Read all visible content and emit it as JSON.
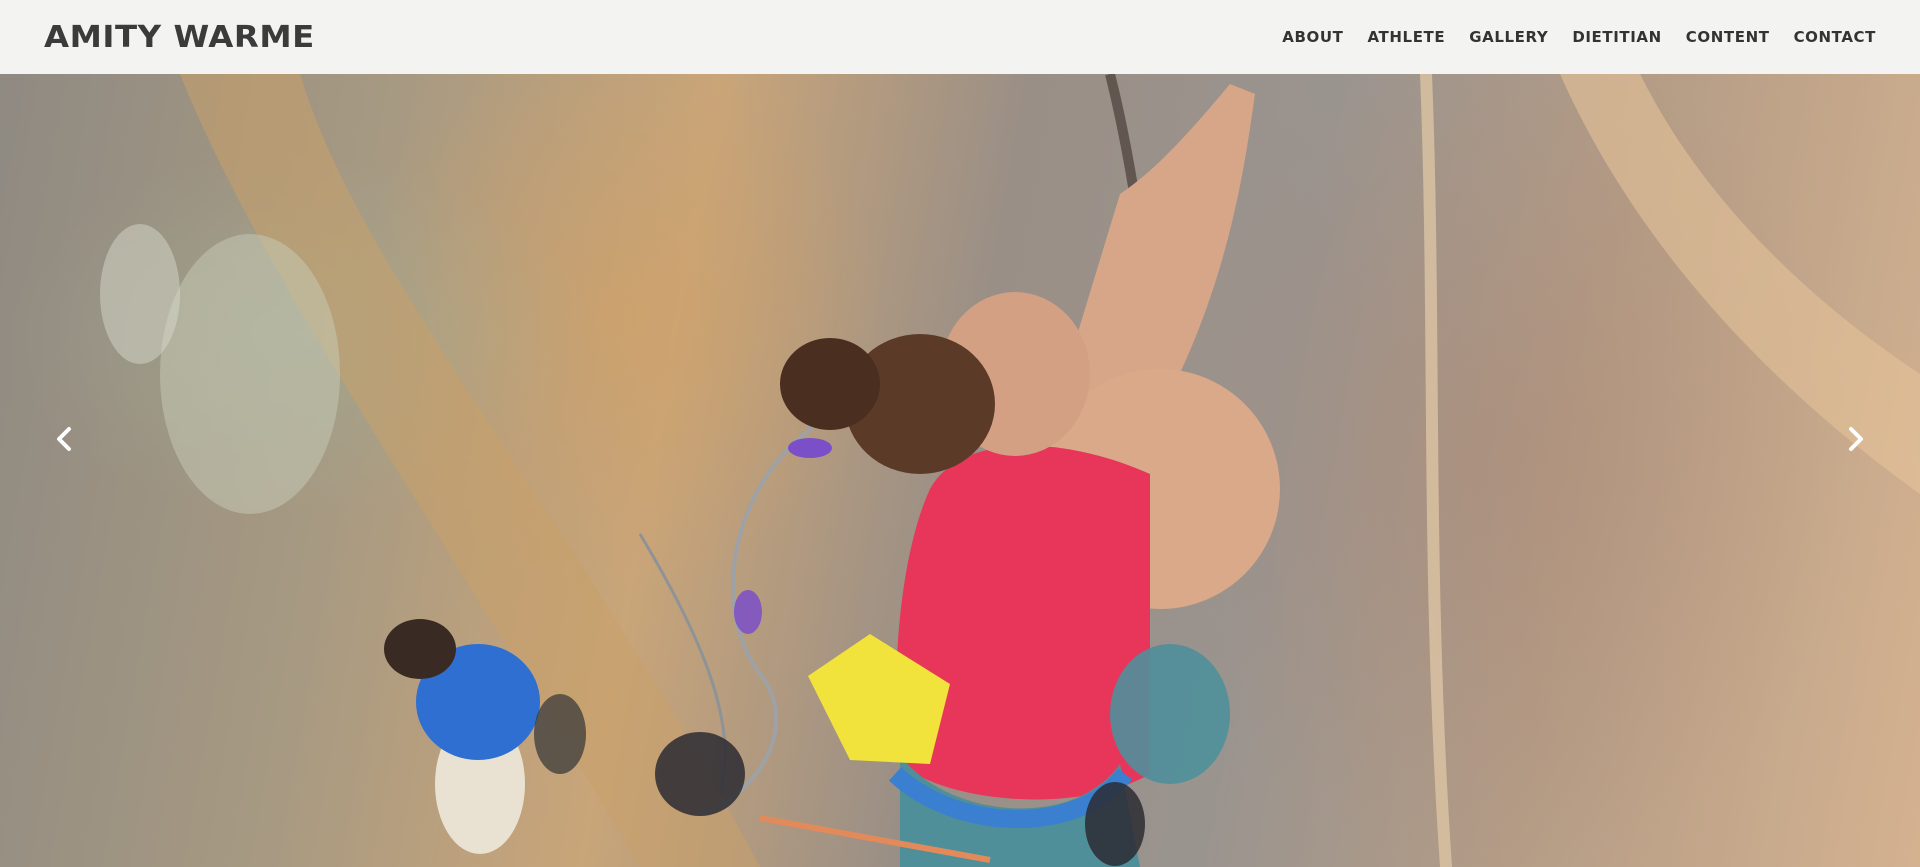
{
  "site": {
    "brand": "AMITY WARME"
  },
  "nav": [
    {
      "label": "ABOUT"
    },
    {
      "label": "ATHLETE"
    },
    {
      "label": "GALLERY"
    },
    {
      "label": "DIETITIAN"
    },
    {
      "label": "CONTENT"
    },
    {
      "label": "CONTACT"
    }
  ],
  "hero": {
    "prev_icon": "chevron-left-icon",
    "next_icon": "chevron-right-icon",
    "colors": {
      "tank_top": "#e8355a",
      "chalk_bag": "#f2e23c",
      "belayer_shirt": "#2e6fd1",
      "pants": "#4f8f9a"
    }
  }
}
